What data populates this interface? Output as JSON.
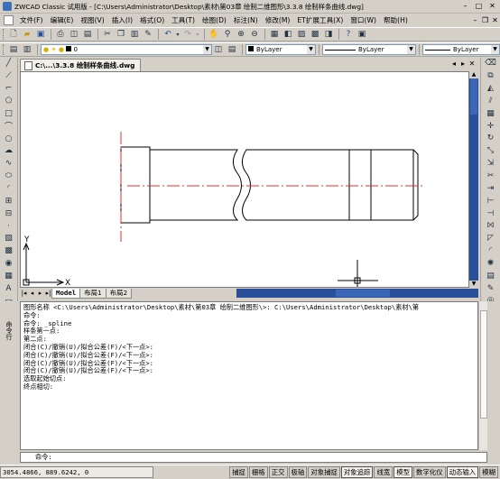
{
  "titlebar": {
    "title": "ZWCAD Classic 试用版 - [C:\\Users\\Administrator\\Desktop\\素材\\第03章 绘制二维图形\\3.3.8 绘制样条曲线.dwg]",
    "minimize": "–",
    "maximize": "□",
    "close": "✕"
  },
  "menubar": {
    "items": [
      "文件(F)",
      "编辑(E)",
      "视图(V)",
      "插入(I)",
      "格式(O)",
      "工具(T)",
      "绘图(D)",
      "标注(N)",
      "修改(M)",
      "ET扩展工具(X)",
      "窗口(W)",
      "帮助(H)"
    ],
    "doc_min": "–",
    "doc_restore": "❐",
    "doc_close": "✕"
  },
  "toolbar2": {
    "layer_value": "0",
    "color_value": "ByLayer",
    "linetype_value": "ByLayer",
    "lineweight_value": "ByLayer"
  },
  "document": {
    "tab_label": "C:\\...\\3.3.8 绘制样条曲线.dwg"
  },
  "layouts": {
    "tabs": [
      "Model",
      "布局1",
      "布局2"
    ],
    "active": "Model"
  },
  "ucs": {
    "x_label": "X",
    "y_label": "Y"
  },
  "command": {
    "side_label": "命令行",
    "history": [
      "图形名称 <C:\\Users\\Administrator\\Desktop\\素材\\第03章 绘制二维图形\\>: C:\\Users\\Administrator\\Desktop\\素材\\第",
      "命令:",
      "命令: _spline",
      "样条第一点:",
      "第二点:",
      "闭合(C)/撤销(U)/拟合公差(F)/<下一点>:",
      "闭合(C)/撤销(U)/拟合公差(F)/<下一点>:",
      "闭合(C)/撤销(U)/拟合公差(F)/<下一点>:",
      "闭合(C)/撤销(U)/拟合公差(F)/<下一点>:",
      "选取起始切点:",
      "终点相切:"
    ],
    "prompt": "命令:"
  },
  "statusbar": {
    "coords": "3054.4866, 889.6242, 0",
    "buttons": [
      {
        "label": "捕捉",
        "on": false
      },
      {
        "label": "栅格",
        "on": false
      },
      {
        "label": "正交",
        "on": false
      },
      {
        "label": "极轴",
        "on": false
      },
      {
        "label": "对象捕捉",
        "on": false
      },
      {
        "label": "对象追踪",
        "on": true
      },
      {
        "label": "线宽",
        "on": false
      },
      {
        "label": "模型",
        "on": true
      },
      {
        "label": "数字化仪",
        "on": false
      },
      {
        "label": "动态输入",
        "on": true
      },
      {
        "label": "模糊",
        "on": false
      }
    ]
  },
  "colors": {
    "centerline": "#e03030",
    "scroll_blue": "#2a4f9a",
    "app_background": "#d4d0c8"
  }
}
